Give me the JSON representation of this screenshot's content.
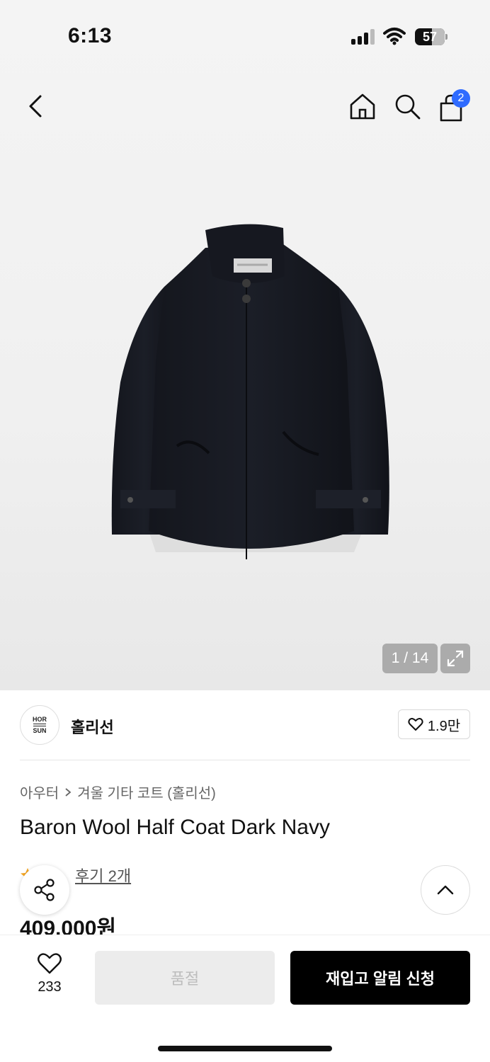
{
  "status_bar": {
    "time": "6:13",
    "battery": "57"
  },
  "nav": {
    "cart_badge": "2"
  },
  "gallery": {
    "counter": "1 / 14"
  },
  "brand": {
    "logo_line1": "HOR",
    "logo_line2": "SUN",
    "name": "홀리선",
    "likes": "1.9만"
  },
  "breadcrumb": {
    "level1": "아우터",
    "level2": "겨울 기타 코트 (홀리선)"
  },
  "product": {
    "title": "Baron Wool Half Coat Dark Navy",
    "review_link": "후기 2개",
    "price": "409,000원"
  },
  "bottom_bar": {
    "wish_count": "233",
    "soldout_label": "품절",
    "restock_label": "재입고 알림 신청"
  },
  "colors": {
    "accent_badge": "#2f6bff",
    "primary_button": "#000000",
    "disabled_button": "#ececec",
    "star": "#f5a623"
  }
}
